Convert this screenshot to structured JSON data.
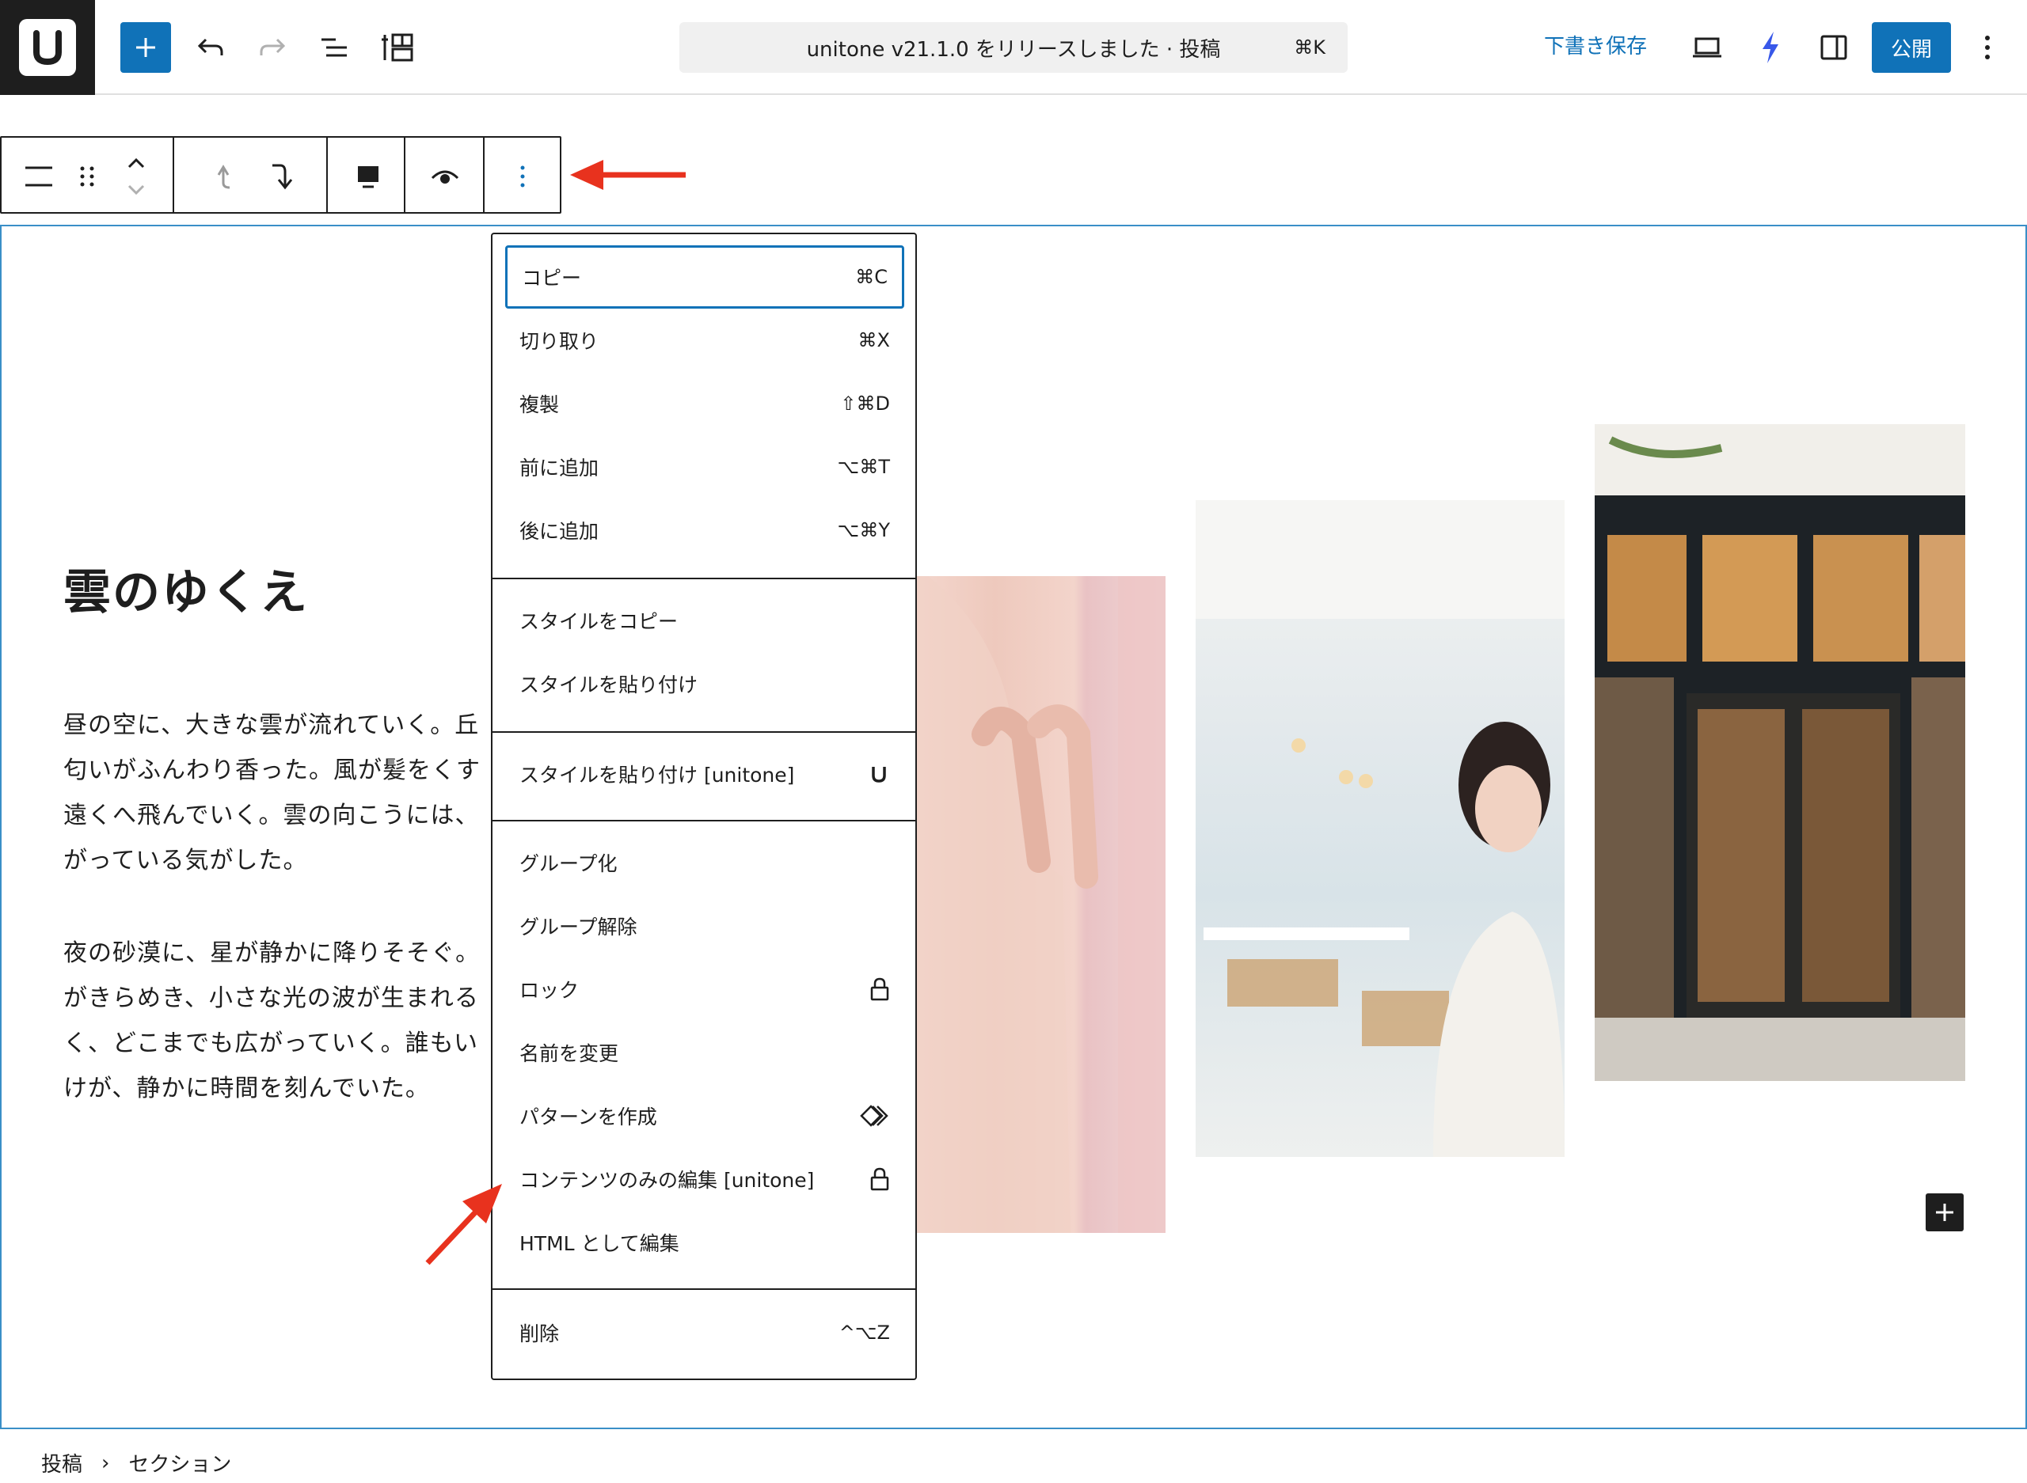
{
  "topbar": {
    "document_title": "unitone v21.1.0 をリリースしました · 投稿",
    "command_shortcut": "⌘K",
    "save_draft_label": "下書き保存",
    "publish_label": "公開",
    "accent_color": "#1072b8"
  },
  "block_toolbar": {
    "icons": [
      "section-icon",
      "drag-handle-icon",
      "move-up-down-icon",
      "select-parent-icon",
      "move-next-icon",
      "align-icon",
      "preview-icon",
      "more-options-icon"
    ]
  },
  "content": {
    "heading": "雲のゆくえ",
    "paragraph1": [
      "昼の空に、大きな雲が流れていく。丘",
      "匂いがふんわり香った。風が髪をくす",
      "遠くへ飛んでいく。雲の向こうには、",
      "がっている気がした。"
    ],
    "paragraph2": [
      "夜の砂漠に、星が静かに降りそそぐ。",
      "がきらめき、小さな光の波が生まれる",
      "く、どこまでも広がっていく。誰もい",
      "けが、静かに時間を刻んでいた。"
    ]
  },
  "menu": {
    "group1": [
      {
        "label": "コピー",
        "shortcut": "⌘C"
      },
      {
        "label": "切り取り",
        "shortcut": "⌘X"
      },
      {
        "label": "複製",
        "shortcut": "⇧⌘D"
      },
      {
        "label": "前に追加",
        "shortcut": "⌥⌘T"
      },
      {
        "label": "後に追加",
        "shortcut": "⌥⌘Y"
      }
    ],
    "group2": [
      {
        "label": "スタイルをコピー"
      },
      {
        "label": "スタイルを貼り付け"
      }
    ],
    "group3": [
      {
        "label": "スタイルを貼り付け [unitone]",
        "icon": "unitone-icon"
      }
    ],
    "group4": [
      {
        "label": "グループ化"
      },
      {
        "label": "グループ解除"
      },
      {
        "label": "ロック",
        "icon": "lock-icon"
      },
      {
        "label": "名前を変更"
      },
      {
        "label": "パターンを作成",
        "icon": "pattern-icon"
      },
      {
        "label": "コンテンツのみの編集 [unitone]",
        "icon": "lock-icon"
      },
      {
        "label": "HTML として編集"
      }
    ],
    "group5": [
      {
        "label": "削除",
        "shortcut": "^⌥Z"
      }
    ]
  },
  "breadcrumb": {
    "items": [
      "投稿",
      "セクション"
    ],
    "separator": "›"
  }
}
